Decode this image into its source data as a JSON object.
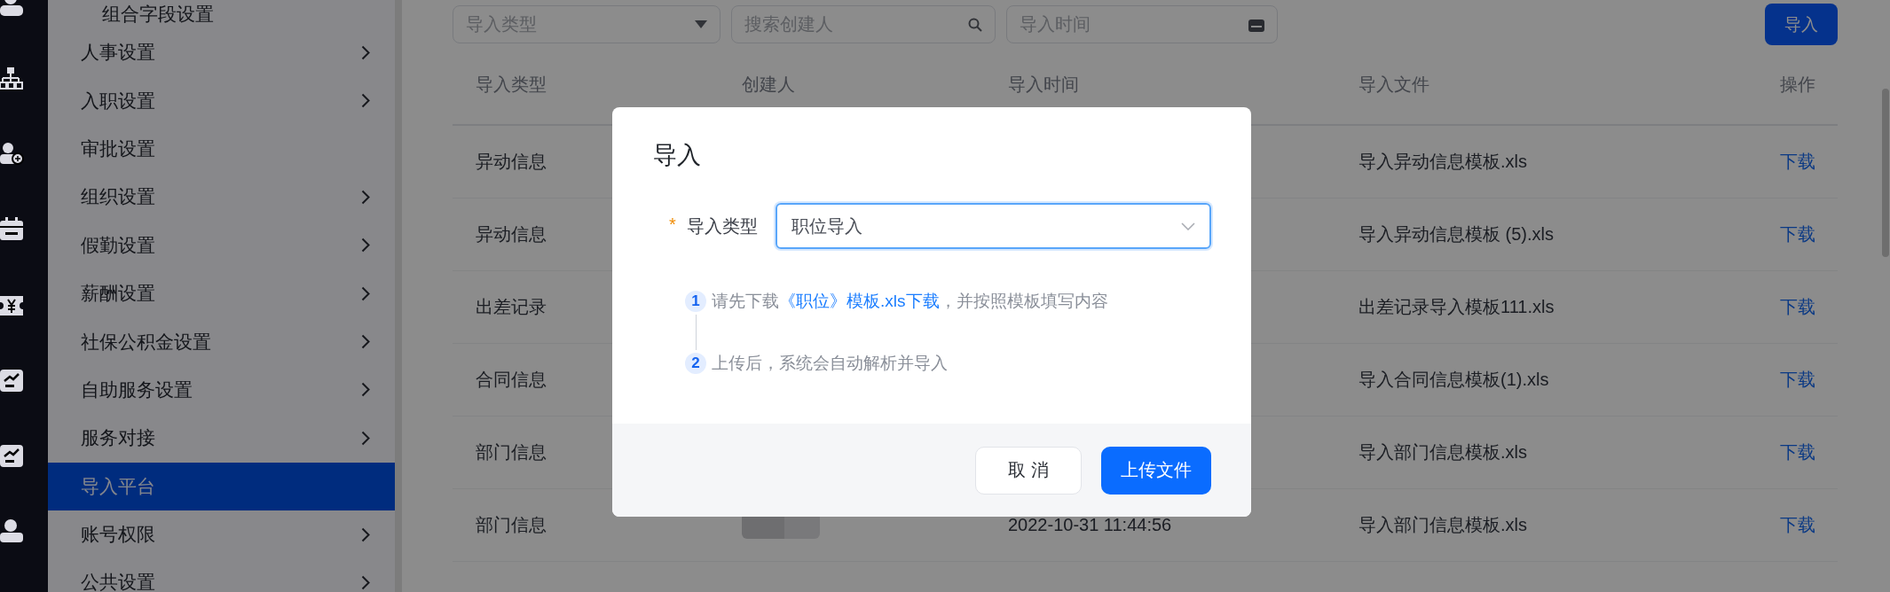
{
  "sidebar": {
    "items": [
      {
        "label": "组合字段设置",
        "kind": "subitem",
        "expandable": false,
        "selected": false
      },
      {
        "label": "人事设置",
        "kind": "item",
        "expandable": true,
        "selected": false
      },
      {
        "label": "入职设置",
        "kind": "item",
        "expandable": true,
        "selected": false
      },
      {
        "label": "审批设置",
        "kind": "item",
        "expandable": false,
        "selected": false
      },
      {
        "label": "组织设置",
        "kind": "item",
        "expandable": true,
        "selected": false
      },
      {
        "label": "假勤设置",
        "kind": "item",
        "expandable": true,
        "selected": false
      },
      {
        "label": "薪酬设置",
        "kind": "item",
        "expandable": true,
        "selected": false
      },
      {
        "label": "社保公积金设置",
        "kind": "item",
        "expandable": true,
        "selected": false
      },
      {
        "label": "自助服务设置",
        "kind": "item",
        "expandable": true,
        "selected": false
      },
      {
        "label": "服务对接",
        "kind": "item",
        "expandable": true,
        "selected": false
      },
      {
        "label": "导入平台",
        "kind": "item",
        "expandable": false,
        "selected": true
      },
      {
        "label": "账号权限",
        "kind": "item",
        "expandable": true,
        "selected": false
      },
      {
        "label": "公共设置",
        "kind": "item",
        "expandable": true,
        "selected": false
      }
    ]
  },
  "filters": {
    "type_select": {
      "placeholder": "导入类型"
    },
    "creator_search": {
      "placeholder": "搜索创建人"
    },
    "time_picker": {
      "placeholder": "导入时间"
    },
    "import_button": "导入"
  },
  "table": {
    "columns": [
      "导入类型",
      "创建人",
      "导入时间",
      "导入文件",
      "操作"
    ],
    "rows": [
      {
        "type": "异动信息",
        "file": "导入异动信息模板.xls",
        "action": "下载"
      },
      {
        "type": "异动信息",
        "file": "导入异动信息模板 (5).xls",
        "action": "下载"
      },
      {
        "type": "出差记录",
        "file": "出差记录导入模板111.xls",
        "action": "下载"
      },
      {
        "type": "合同信息",
        "file": "导入合同信息模板(1).xls",
        "action": "下载"
      },
      {
        "type": "部门信息",
        "file": "导入部门信息模板.xls",
        "action": "下载"
      },
      {
        "type": "部门信息",
        "time": "2022-10-31 11:44:56",
        "file": "导入部门信息模板.xls",
        "action": "下载"
      }
    ]
  },
  "modal": {
    "title": "导入",
    "field": {
      "label": "导入类型",
      "required_mark": "*",
      "value": "职位导入"
    },
    "steps": [
      {
        "number": "1",
        "parts": [
          {
            "kind": "text",
            "text": "请先下载"
          },
          {
            "kind": "link",
            "text": "《职位》模板.xls下载"
          },
          {
            "kind": "text",
            "text": "，并按照模板填写内容"
          }
        ]
      },
      {
        "number": "2",
        "parts": [
          {
            "kind": "text",
            "text": "上传后，系统会自动解析并导入"
          }
        ]
      }
    ],
    "buttons": [
      {
        "label": "取 消",
        "kind": "secondary"
      },
      {
        "label": "上传文件",
        "kind": "primary"
      }
    ]
  }
}
